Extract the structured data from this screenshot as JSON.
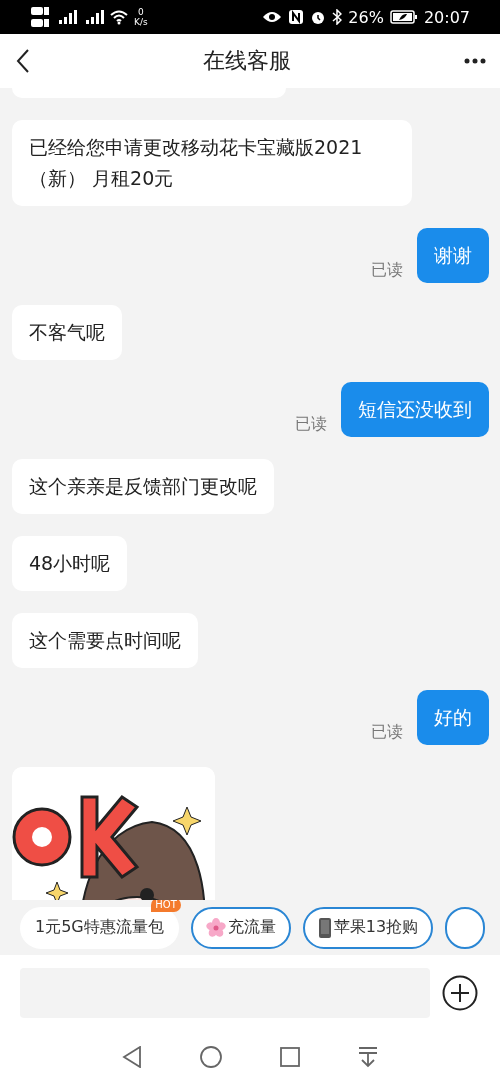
{
  "status_bar": {
    "network_speed": "0",
    "speed_unit": "K/s",
    "battery": "26%",
    "time": "20:07"
  },
  "header": {
    "title": "在线客服"
  },
  "messages": [
    {
      "kind": "partial"
    },
    {
      "kind": "agent",
      "text": "已经给您申请更改移动花卡宝藏版2021（新） 月租20元"
    },
    {
      "kind": "user",
      "text": "谢谢",
      "status": "已读"
    },
    {
      "kind": "agent",
      "text": "不客气呢"
    },
    {
      "kind": "user",
      "text": "短信还没收到",
      "status": "已读"
    },
    {
      "kind": "agent",
      "text": "这个亲亲是反馈部门更改呢"
    },
    {
      "kind": "agent",
      "text": "48小时呢"
    },
    {
      "kind": "agent",
      "text": "这个需要点时间呢"
    },
    {
      "kind": "user",
      "text": "好的",
      "status": "已读"
    },
    {
      "kind": "sticker"
    }
  ],
  "quick_replies": [
    {
      "kind": "hot",
      "label": "1元5G特惠流量包",
      "badge": "HOT"
    },
    {
      "kind": "flower",
      "label": "充流量"
    },
    {
      "kind": "phone",
      "label": "苹果13抢购"
    },
    {
      "kind": "partial"
    }
  ]
}
